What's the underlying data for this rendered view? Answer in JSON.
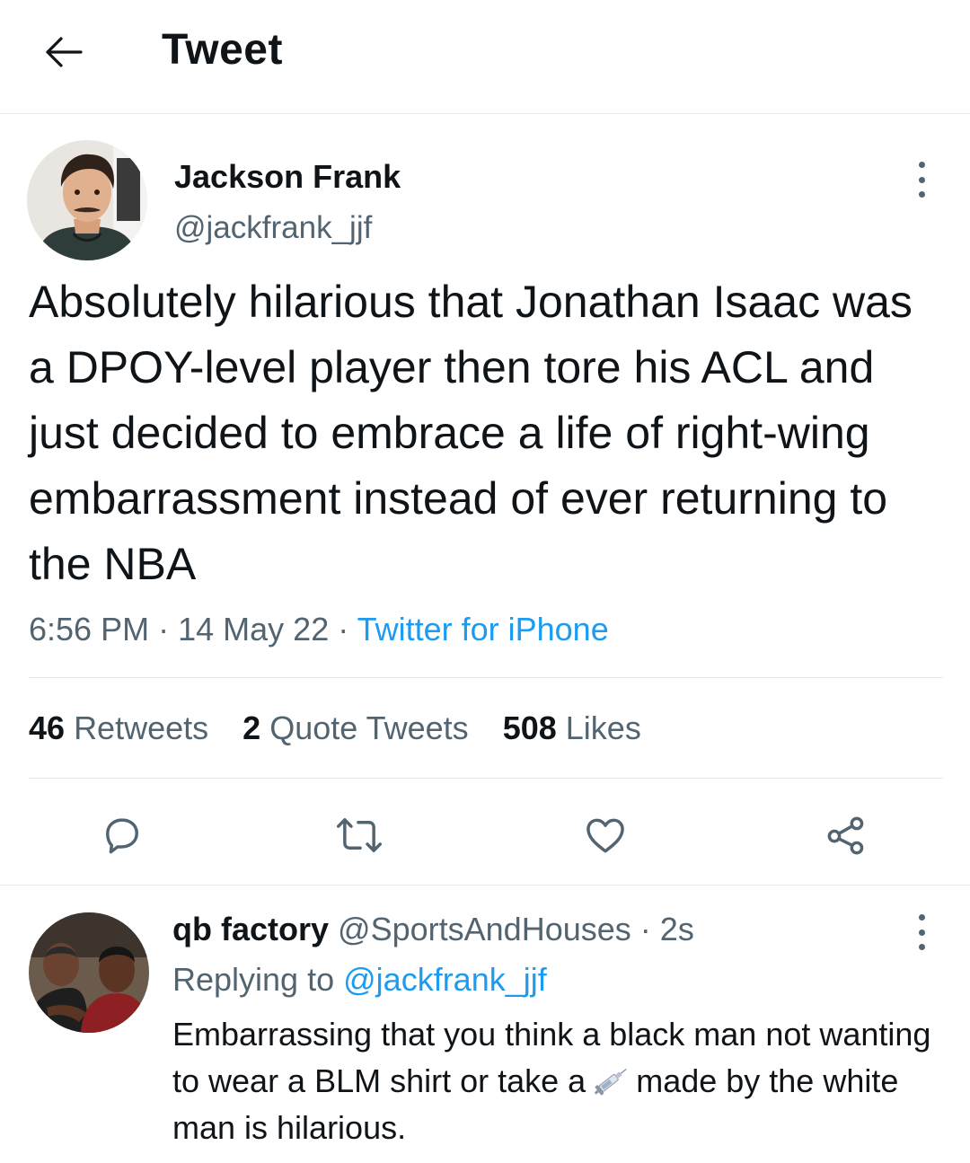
{
  "header": {
    "title": "Tweet",
    "back_icon": "arrow-left-icon"
  },
  "tweet": {
    "author": {
      "display_name": "Jackson Frank",
      "handle": "@jackfrank_jjf"
    },
    "text": "Absolutely hilarious that Jonathan Isaac was a DPOY-level player then tore his ACL and just decided to embrace a life of right-wing embarrassment instead of ever returning to the NBA",
    "time": "6:56 PM",
    "separator": "·",
    "date": "14 May 22",
    "source": "Twitter for iPhone",
    "stats": {
      "retweets_count": "46",
      "retweets_label": "Retweets",
      "quotes_count": "2",
      "quotes_label": "Quote Tweets",
      "likes_count": "508",
      "likes_label": "Likes"
    },
    "actions": [
      "reply-icon",
      "retweet-icon",
      "like-icon",
      "share-icon"
    ]
  },
  "reply": {
    "author": {
      "display_name": "qb factory",
      "handle": "@SportsAndHouses"
    },
    "separator": "·",
    "time_ago": "2s",
    "replying_prefix": "Replying to",
    "replying_to": "@jackfrank_jjf",
    "text_before_emoji": "Embarrassing that you think a black man not wanting to wear a BLM shirt or take a",
    "emoji": "syringe-emoji",
    "text_after_emoji": "made by the white man is hilarious."
  },
  "colors": {
    "text": "#0f1419",
    "secondary": "#536471",
    "accent": "#1d9bf0",
    "divider": "#e6e8ea"
  }
}
